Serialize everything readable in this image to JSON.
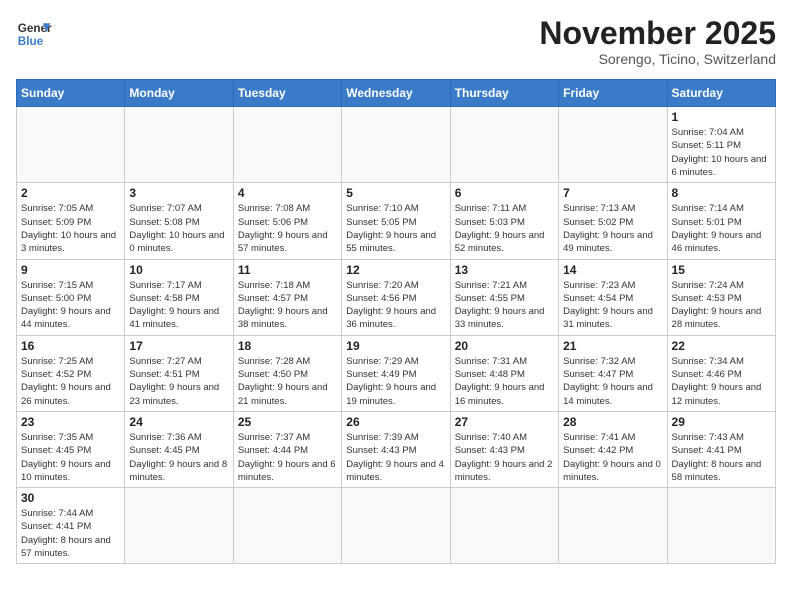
{
  "header": {
    "logo_general": "General",
    "logo_blue": "Blue",
    "month_title": "November 2025",
    "subtitle": "Sorengo, Ticino, Switzerland"
  },
  "weekdays": [
    "Sunday",
    "Monday",
    "Tuesday",
    "Wednesday",
    "Thursday",
    "Friday",
    "Saturday"
  ],
  "weeks": [
    [
      {
        "day": "",
        "info": ""
      },
      {
        "day": "",
        "info": ""
      },
      {
        "day": "",
        "info": ""
      },
      {
        "day": "",
        "info": ""
      },
      {
        "day": "",
        "info": ""
      },
      {
        "day": "",
        "info": ""
      },
      {
        "day": "1",
        "info": "Sunrise: 7:04 AM\nSunset: 5:11 PM\nDaylight: 10 hours and 6 minutes."
      }
    ],
    [
      {
        "day": "2",
        "info": "Sunrise: 7:05 AM\nSunset: 5:09 PM\nDaylight: 10 hours and 3 minutes."
      },
      {
        "day": "3",
        "info": "Sunrise: 7:07 AM\nSunset: 5:08 PM\nDaylight: 10 hours and 0 minutes."
      },
      {
        "day": "4",
        "info": "Sunrise: 7:08 AM\nSunset: 5:06 PM\nDaylight: 9 hours and 57 minutes."
      },
      {
        "day": "5",
        "info": "Sunrise: 7:10 AM\nSunset: 5:05 PM\nDaylight: 9 hours and 55 minutes."
      },
      {
        "day": "6",
        "info": "Sunrise: 7:11 AM\nSunset: 5:03 PM\nDaylight: 9 hours and 52 minutes."
      },
      {
        "day": "7",
        "info": "Sunrise: 7:13 AM\nSunset: 5:02 PM\nDaylight: 9 hours and 49 minutes."
      },
      {
        "day": "8",
        "info": "Sunrise: 7:14 AM\nSunset: 5:01 PM\nDaylight: 9 hours and 46 minutes."
      }
    ],
    [
      {
        "day": "9",
        "info": "Sunrise: 7:15 AM\nSunset: 5:00 PM\nDaylight: 9 hours and 44 minutes."
      },
      {
        "day": "10",
        "info": "Sunrise: 7:17 AM\nSunset: 4:58 PM\nDaylight: 9 hours and 41 minutes."
      },
      {
        "day": "11",
        "info": "Sunrise: 7:18 AM\nSunset: 4:57 PM\nDaylight: 9 hours and 38 minutes."
      },
      {
        "day": "12",
        "info": "Sunrise: 7:20 AM\nSunset: 4:56 PM\nDaylight: 9 hours and 36 minutes."
      },
      {
        "day": "13",
        "info": "Sunrise: 7:21 AM\nSunset: 4:55 PM\nDaylight: 9 hours and 33 minutes."
      },
      {
        "day": "14",
        "info": "Sunrise: 7:23 AM\nSunset: 4:54 PM\nDaylight: 9 hours and 31 minutes."
      },
      {
        "day": "15",
        "info": "Sunrise: 7:24 AM\nSunset: 4:53 PM\nDaylight: 9 hours and 28 minutes."
      }
    ],
    [
      {
        "day": "16",
        "info": "Sunrise: 7:25 AM\nSunset: 4:52 PM\nDaylight: 9 hours and 26 minutes."
      },
      {
        "day": "17",
        "info": "Sunrise: 7:27 AM\nSunset: 4:51 PM\nDaylight: 9 hours and 23 minutes."
      },
      {
        "day": "18",
        "info": "Sunrise: 7:28 AM\nSunset: 4:50 PM\nDaylight: 9 hours and 21 minutes."
      },
      {
        "day": "19",
        "info": "Sunrise: 7:29 AM\nSunset: 4:49 PM\nDaylight: 9 hours and 19 minutes."
      },
      {
        "day": "20",
        "info": "Sunrise: 7:31 AM\nSunset: 4:48 PM\nDaylight: 9 hours and 16 minutes."
      },
      {
        "day": "21",
        "info": "Sunrise: 7:32 AM\nSunset: 4:47 PM\nDaylight: 9 hours and 14 minutes."
      },
      {
        "day": "22",
        "info": "Sunrise: 7:34 AM\nSunset: 4:46 PM\nDaylight: 9 hours and 12 minutes."
      }
    ],
    [
      {
        "day": "23",
        "info": "Sunrise: 7:35 AM\nSunset: 4:45 PM\nDaylight: 9 hours and 10 minutes."
      },
      {
        "day": "24",
        "info": "Sunrise: 7:36 AM\nSunset: 4:45 PM\nDaylight: 9 hours and 8 minutes."
      },
      {
        "day": "25",
        "info": "Sunrise: 7:37 AM\nSunset: 4:44 PM\nDaylight: 9 hours and 6 minutes."
      },
      {
        "day": "26",
        "info": "Sunrise: 7:39 AM\nSunset: 4:43 PM\nDaylight: 9 hours and 4 minutes."
      },
      {
        "day": "27",
        "info": "Sunrise: 7:40 AM\nSunset: 4:43 PM\nDaylight: 9 hours and 2 minutes."
      },
      {
        "day": "28",
        "info": "Sunrise: 7:41 AM\nSunset: 4:42 PM\nDaylight: 9 hours and 0 minutes."
      },
      {
        "day": "29",
        "info": "Sunrise: 7:43 AM\nSunset: 4:41 PM\nDaylight: 8 hours and 58 minutes."
      }
    ],
    [
      {
        "day": "30",
        "info": "Sunrise: 7:44 AM\nSunset: 4:41 PM\nDaylight: 8 hours and 57 minutes."
      },
      {
        "day": "",
        "info": ""
      },
      {
        "day": "",
        "info": ""
      },
      {
        "day": "",
        "info": ""
      },
      {
        "day": "",
        "info": ""
      },
      {
        "day": "",
        "info": ""
      },
      {
        "day": "",
        "info": ""
      }
    ]
  ]
}
